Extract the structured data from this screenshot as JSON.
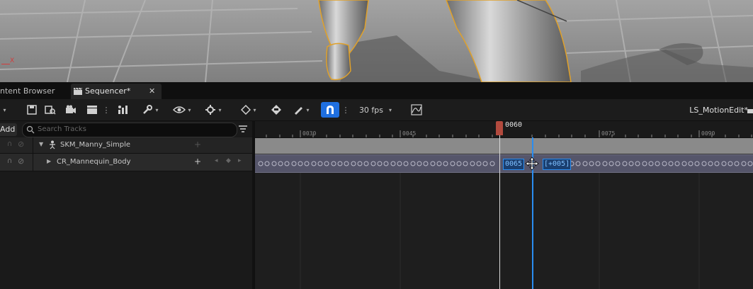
{
  "tabs": {
    "content_browser": "ntent Browser",
    "sequencer": "Sequencer*"
  },
  "toolbar": {
    "fps": "30 fps",
    "sequence_name": "LS_MotionEdit*"
  },
  "tracks": {
    "add_label": "Add",
    "search_placeholder": "Search Tracks",
    "rows": [
      {
        "label": "SKM_Manny_Simple"
      },
      {
        "label": "CR_Mannequin_Body"
      }
    ]
  },
  "timeline": {
    "playhead_frame": "0060",
    "ruler_ticks": [
      "0030",
      "0045",
      "0075",
      "0090"
    ],
    "drag_frame": "0065",
    "drag_offset": "[+005]"
  },
  "viewport": {
    "axis_label": "X"
  },
  "colors": {
    "accent": "#1f6fe0",
    "playhead": "#b24a3e",
    "selection": "#2a8df0"
  }
}
